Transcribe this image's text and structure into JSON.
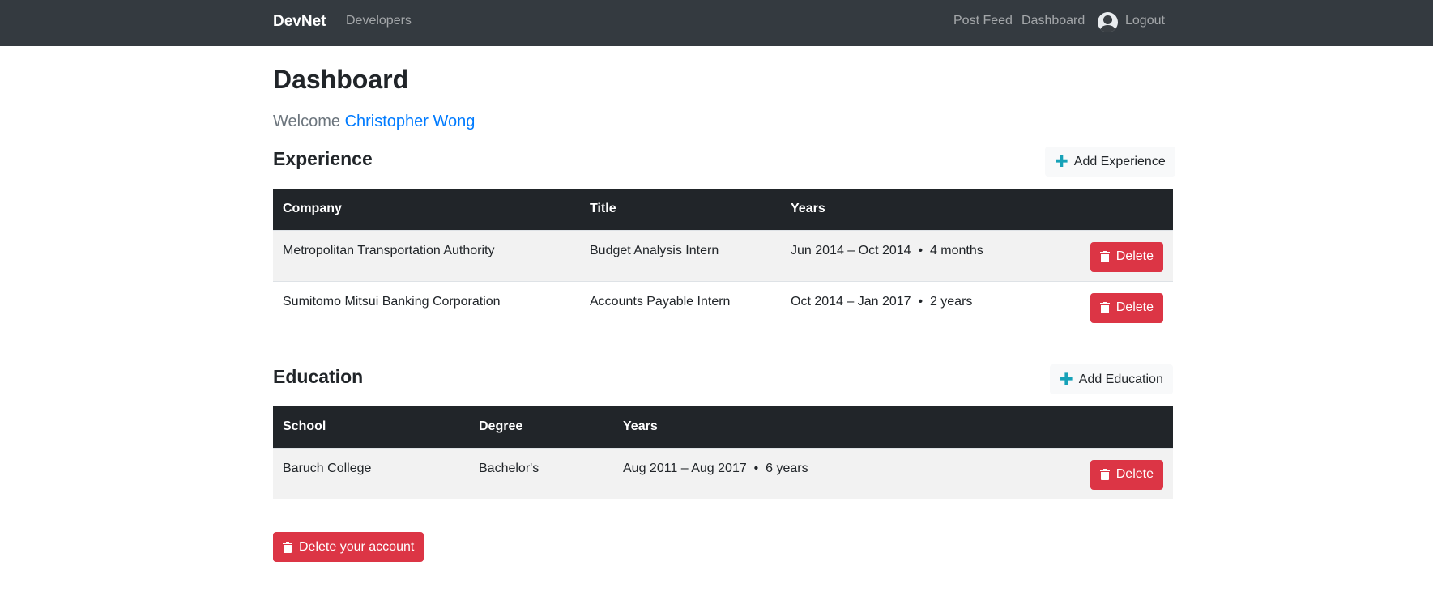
{
  "nav": {
    "brand": "DevNet",
    "developers": "Developers",
    "post_feed": "Post Feed",
    "dashboard": "Dashboard",
    "logout": "Logout"
  },
  "page": {
    "title": "Dashboard",
    "welcome_prefix": "Welcome",
    "user_name": "Christopher Wong"
  },
  "experience": {
    "title": "Experience",
    "add_label": "Add Experience",
    "headers": [
      "Company",
      "Title",
      "Years"
    ],
    "rows": [
      {
        "company": "Metropolitan Transportation Authority",
        "title": "Budget Analysis Intern",
        "years": "Jun 2014 – Oct 2014  •  4 months",
        "delete": "Delete"
      },
      {
        "company": "Sumitomo Mitsui Banking Corporation",
        "title": "Accounts Payable Intern",
        "years": "Oct 2014 – Jan 2017  •  2 years",
        "delete": "Delete"
      }
    ]
  },
  "education": {
    "title": "Education",
    "add_label": "Add Education",
    "headers": [
      "School",
      "Degree",
      "Years"
    ],
    "rows": [
      {
        "school": "Baruch College",
        "degree": "Bachelor's",
        "years": "Aug 2011 – Aug 2017  •  6 years",
        "delete": "Delete"
      }
    ]
  },
  "delete_account_label": "Delete your account",
  "colors": {
    "navbar": "#343a40",
    "danger": "#dc3545",
    "link": "#007bff",
    "info": "#17a2b8",
    "table_head": "#212529"
  }
}
